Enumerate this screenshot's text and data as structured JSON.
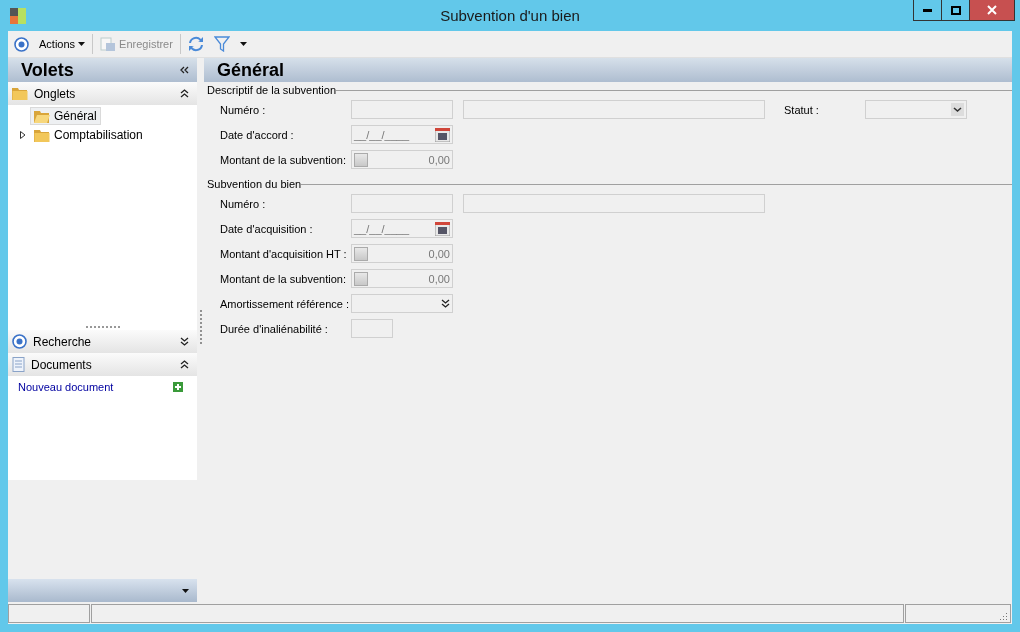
{
  "window": {
    "title": "Subvention d'un bien"
  },
  "toolbar": {
    "items": [
      {
        "kind": "icon"
      },
      {
        "kind": "menu",
        "label": "Actions"
      },
      {
        "kind": "sep"
      },
      {
        "kind": "save",
        "label": "Enregistrer",
        "disabled": true
      },
      {
        "kind": "sep"
      },
      {
        "kind": "refresh"
      },
      {
        "kind": "filter"
      },
      {
        "kind": "caret"
      }
    ]
  },
  "sidebar": {
    "title": "Volets",
    "onglets": {
      "title": "Onglets",
      "expanded": true,
      "items": [
        {
          "label": "Général",
          "selected": true
        },
        {
          "label": "Comptabilisation",
          "selected": false,
          "expanded": false
        }
      ]
    },
    "recherche": {
      "title": "Recherche",
      "expanded": false
    },
    "documents": {
      "title": "Documents",
      "expanded": true,
      "link": "Nouveau document"
    }
  },
  "page": {
    "title": "Général",
    "sections": [
      {
        "title": "Descriptif de la subvention",
        "fields": [
          {
            "kind": "code",
            "label": "Numéro :",
            "extra": {
              "label": "Statut :",
              "kind": "combo"
            }
          },
          {
            "kind": "date",
            "label": "Date d'accord :",
            "value": "__/__/____"
          },
          {
            "kind": "amount",
            "label": "Montant de la subvention:",
            "value": "0,00",
            "checked": false
          }
        ]
      },
      {
        "title": "Subvention du bien",
        "fields": [
          {
            "kind": "code",
            "label": "Numéro :"
          },
          {
            "kind": "date",
            "label": "Date d'acquisition :",
            "value": "__/__/____"
          },
          {
            "kind": "amount",
            "label": "Montant d'acquisition HT :",
            "value": "0,00",
            "checked": false
          },
          {
            "kind": "amount",
            "label": "Montant de la subvention:",
            "value": "0,00",
            "checked": false
          },
          {
            "kind": "dropdown",
            "label": "Amortissement référence :"
          },
          {
            "kind": "short",
            "label": "Durée d'inaliénabilité :"
          }
        ]
      }
    ]
  }
}
